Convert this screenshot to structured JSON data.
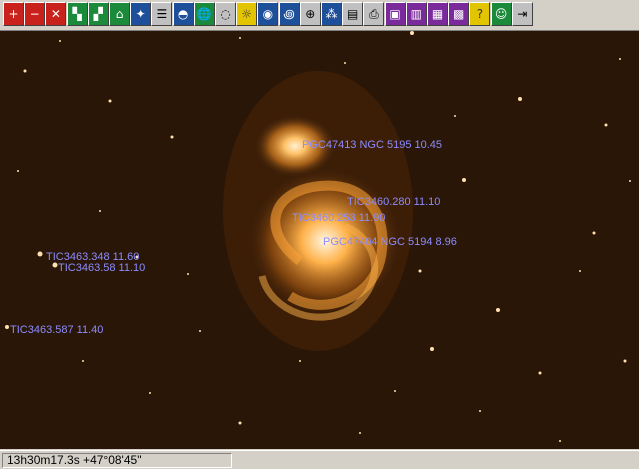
{
  "toolbar": {
    "buttons": [
      {
        "name": "zoom-in-icon",
        "glyph": "+"
      },
      {
        "name": "zoom-out-icon",
        "glyph": "−"
      },
      {
        "name": "cancel-icon",
        "glyph": "✕"
      },
      {
        "name": "tool-grid-icon",
        "glyph": "▚"
      },
      {
        "name": "tool-grid2-icon",
        "glyph": "▞"
      },
      {
        "name": "telescope-icon",
        "glyph": "⌂"
      },
      {
        "name": "constellation-icon",
        "glyph": "✦"
      },
      {
        "name": "table-icon",
        "glyph": "☰"
      },
      {
        "name": "horizon-icon",
        "glyph": "◓"
      },
      {
        "name": "globe-icon",
        "glyph": "🌐"
      },
      {
        "name": "galaxy-icon",
        "glyph": "◌"
      },
      {
        "name": "bulb-icon",
        "glyph": "☼"
      },
      {
        "name": "compass-icon",
        "glyph": "◉"
      },
      {
        "name": "spiral-icon",
        "glyph": "꩜"
      },
      {
        "name": "sphere-grid-icon",
        "glyph": "⊕"
      },
      {
        "name": "palette-icon",
        "glyph": "⁂"
      },
      {
        "name": "list-icon",
        "glyph": "▤"
      },
      {
        "name": "print-icon",
        "glyph": "⎙"
      },
      {
        "name": "open-file-icon",
        "glyph": "▣"
      },
      {
        "name": "save-icon",
        "glyph": "▥"
      },
      {
        "name": "save-as-icon",
        "glyph": "▦"
      },
      {
        "name": "image-icon",
        "glyph": "▩"
      },
      {
        "name": "help-icon",
        "glyph": "?"
      },
      {
        "name": "walker-icon",
        "glyph": "☺"
      },
      {
        "name": "exit-icon",
        "glyph": "⇥"
      }
    ]
  },
  "labels": [
    {
      "text": "PGC47413  NGC  5195 10.45"
    },
    {
      "text": "TIC3460.280 11.10"
    },
    {
      "text": "TIC3460.253 11.90"
    },
    {
      "text": "PGC47404  NGC  5194  8.96"
    },
    {
      "text": "TIC3463.348 11.60"
    },
    {
      "text": "TIC3463.58 11.10"
    },
    {
      "text": "TIC3463.587 11.40"
    }
  ],
  "status": {
    "coordinates": "13h30m17.3s +47°08'45\""
  },
  "colors": {
    "sky": "#2a1606",
    "galaxy": "#ffb24a",
    "label": "#8b8cff"
  }
}
